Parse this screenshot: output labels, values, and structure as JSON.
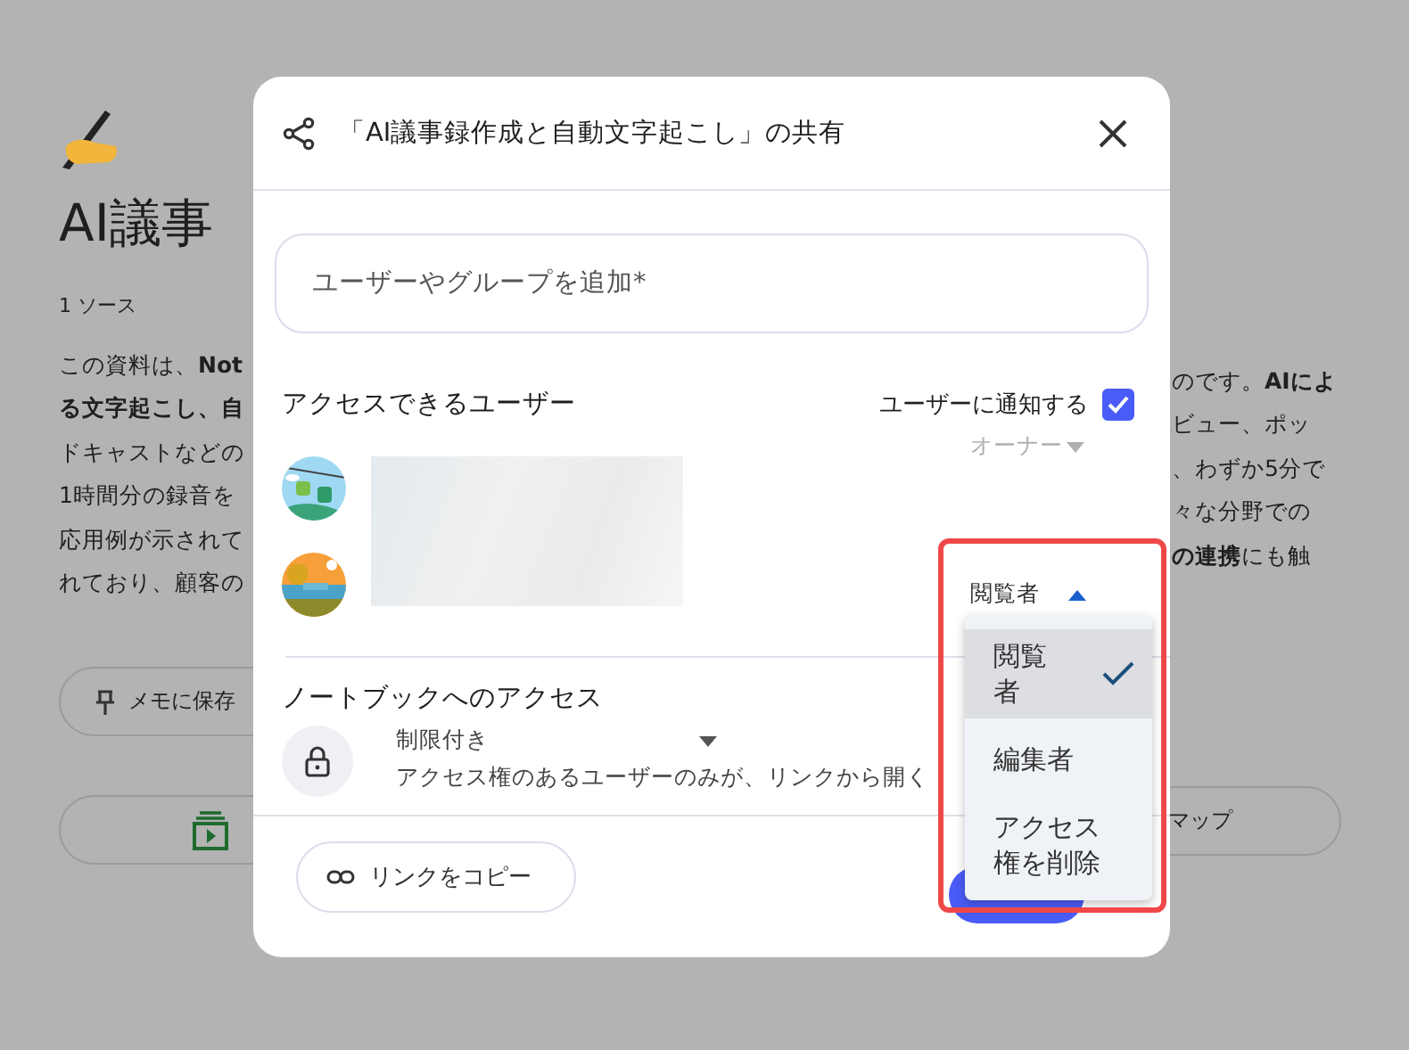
{
  "background": {
    "title": "AI議事",
    "source_count": "1 ソース",
    "paragraph_left": [
      "この資料は、**Not**",
      "**る文字起こし、自**",
      "ドキャストなどの",
      "1時間分の録音を",
      "応用例が示されて",
      "れており、顧客の"
    ],
    "paragraph_right": [
      "のです。**AIによ**",
      "ビュー、ポッ",
      "、わずか5分で",
      "々な分野での",
      "**の連携**にも触"
    ],
    "save_button": "メモに保存",
    "map_button": "マップ"
  },
  "dialog": {
    "title": "「AI議事録作成と自動文字起こし」の共有",
    "add_field": {
      "placeholder": "ユーザーやグループを追加*"
    },
    "access_heading": "アクセスできるユーザー",
    "notify": {
      "label": "ユーザーに通知する",
      "checked": true
    },
    "users": [
      {
        "role": "オーナー",
        "disabled": true,
        "open": false
      },
      {
        "role": "閲覧者",
        "disabled": false,
        "open": true
      }
    ],
    "role_menu": [
      {
        "label": "閲覧者",
        "selected": true
      },
      {
        "label": "編集者",
        "selected": false
      },
      {
        "label": "アクセス権を削除",
        "selected": false
      }
    ],
    "notebook_access": {
      "heading": "ノートブックへのアクセス",
      "mode": "制限付き",
      "description": "アクセス権のあるユーザーのみが、リンクから開く"
    },
    "copy_link": "リンクをコピー"
  },
  "annotation": {
    "highlight": true
  }
}
